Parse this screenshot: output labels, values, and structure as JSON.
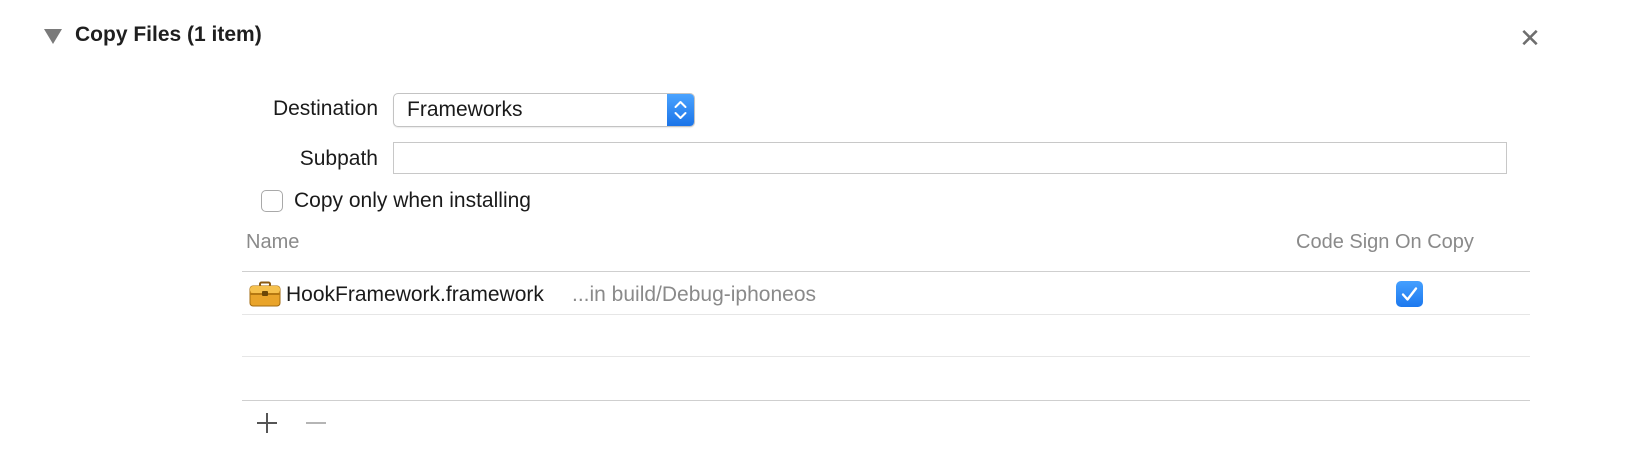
{
  "header": {
    "title": "Copy Files (1 item)",
    "disclosure_icon": "disclosure-triangle-down-icon",
    "close_icon": "close-x-icon"
  },
  "form": {
    "destination_label": "Destination",
    "destination_value": "Frameworks",
    "subpath_label": "Subpath",
    "subpath_value": "",
    "copy_only_label": "Copy only when installing",
    "copy_only_checked": false
  },
  "table": {
    "columns": [
      "Name",
      "Code Sign On Copy"
    ],
    "rows": [
      {
        "icon": "toolbox-framework-icon",
        "name": "HookFramework.framework",
        "location": "...in build/Debug-iphoneos",
        "code_sign": true
      }
    ]
  },
  "footer": {
    "add_icon": "plus-icon",
    "remove_icon": "minus-icon"
  },
  "colors": {
    "accent": "#1b74e8",
    "secondary_text": "#8a8a8a"
  }
}
